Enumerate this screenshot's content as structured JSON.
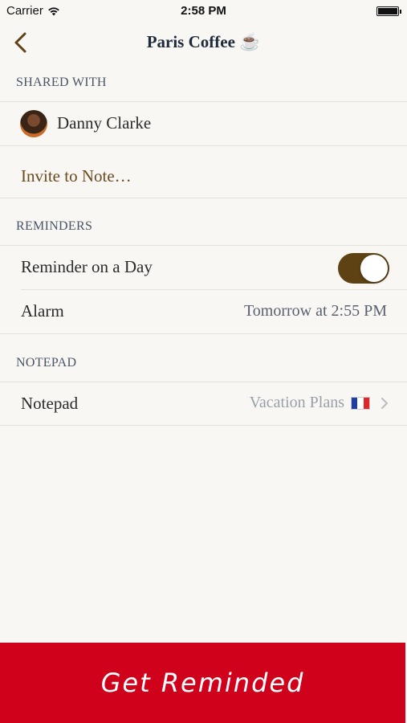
{
  "status_bar": {
    "carrier": "Carrier",
    "time": "2:58 PM"
  },
  "nav": {
    "title": "Paris Coffee ☕"
  },
  "shared": {
    "header": "SHARED WITH",
    "person": "Danny Clarke",
    "invite": "Invite to Note…"
  },
  "reminders": {
    "header": "REMINDERS",
    "day_label": "Reminder on a Day",
    "day_enabled": true,
    "alarm_label": "Alarm",
    "alarm_value": "Tomorrow at 2:55 PM"
  },
  "notepad": {
    "header": "NOTEPAD",
    "label": "Notepad",
    "value": "Vacation Plans"
  },
  "cta": {
    "label": "Get Reminded"
  },
  "colors": {
    "accent_brown": "#5e4213",
    "cta_red": "#d0021b"
  }
}
